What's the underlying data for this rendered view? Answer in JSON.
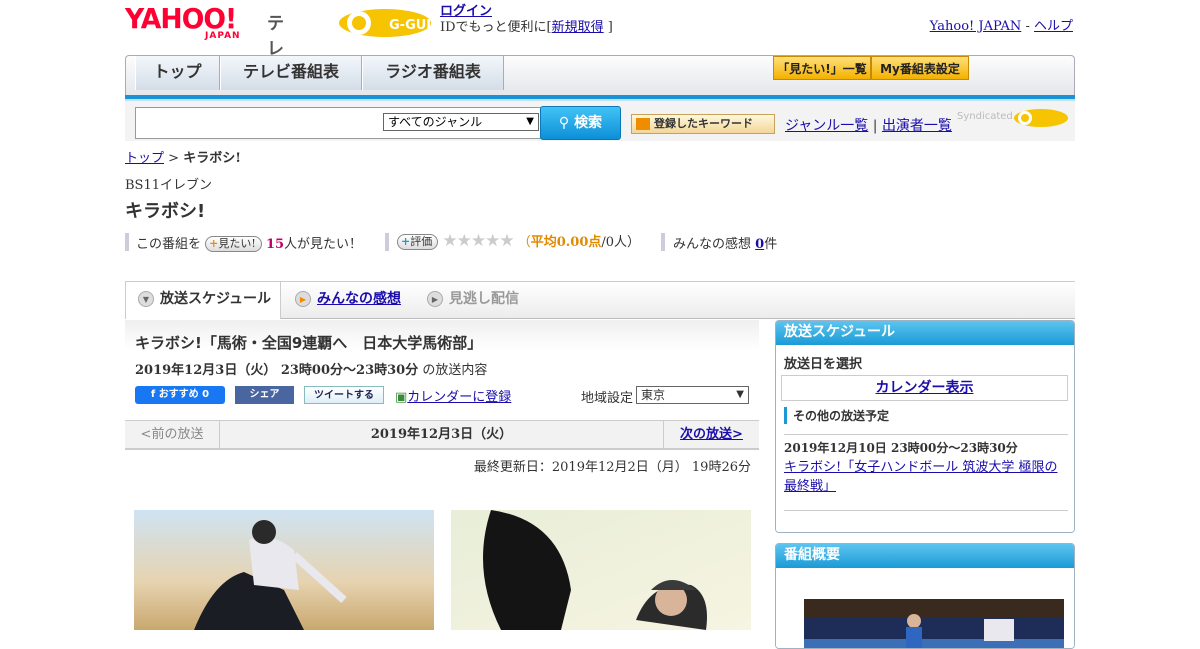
{
  "header": {
    "logo_text": "YAHOO!",
    "logo_sub": "JAPAN",
    "service": "テレビ",
    "gguide_logo": "G-GUIDE",
    "login_link": "ログイン",
    "login_note_pre": "IDでもっと便利に[",
    "signup_link": "新規取得",
    "login_note_post": "]",
    "yahoo_link": "Yahoo! JAPAN",
    "dash": "-",
    "help_link": "ヘルプ"
  },
  "nav": {
    "tabs": [
      "トップ",
      "テレビ番組表",
      "ラジオ番組表"
    ],
    "want_list": "「見たい!」一覧",
    "my_settings": "My番組表設定"
  },
  "search": {
    "placeholder": "",
    "genre": "すべてのジャンル",
    "button": "検索",
    "keyword_button": "登録したキーワード",
    "genre_list": "ジャンル一覧",
    "sep": "|",
    "cast_list": "出演者一覧",
    "syndicated": "Syndicated"
  },
  "breadcrumb": {
    "top": "トップ",
    "sep": ">",
    "current": "キラボシ!"
  },
  "program": {
    "station": "BS11イレブン",
    "title": "キラボシ!",
    "want_pre": "この番組を",
    "want_btn": "見たい!",
    "want_count": "15",
    "want_post": "人が見たい！",
    "rate_btn": "評価",
    "stars": "★★★★★",
    "avg_pre": "（",
    "avg": "平均0.00点",
    "avg_post": "/0人）",
    "impressions_label": "みんなの感想",
    "impressions_count": "0",
    "impressions_unit": "件"
  },
  "tabs": [
    "放送スケジュール",
    "みんなの感想",
    "見逃し配信"
  ],
  "episode": {
    "title": "キラボシ!「馬術・全国9連覇へ　日本大学馬術部」",
    "datetime": "2019年12月3日（火） 23時00分～23時30分",
    "datetime_suffix": "の放送内容",
    "fb_button": "おすすめ 0",
    "fb_share": "シェア",
    "tweet": "ツイートする",
    "calendar": "カレンダーに登録",
    "region_label": "地域設定",
    "region": "東京",
    "prev": "<前の放送",
    "date": "2019年12月3日（火）",
    "next": "次の放送>",
    "updated": "最終更新日：2019年12月2日（月） 19時26分"
  },
  "sidebar": {
    "schedule_title": "放送スケジュール",
    "select_date": "放送日を選択",
    "calendar_btn": "カレンダー表示",
    "other_title": "その他の放送予定",
    "other_time": "2019年12月10日 23時00分～23時30分",
    "other_link": "キラボシ!「女子ハンドボール 筑波大学 極限の最終戦」",
    "summary_title": "番組概要"
  },
  "colors": {
    "accent": "#1b9ad6",
    "brand": "#ff0033",
    "button": "#f4b000"
  },
  "icons": [
    "search-icon",
    "chevron-down-icon",
    "plus-icon",
    "star-icon",
    "facebook-icon",
    "twitter-icon",
    "calendar-icon"
  ]
}
